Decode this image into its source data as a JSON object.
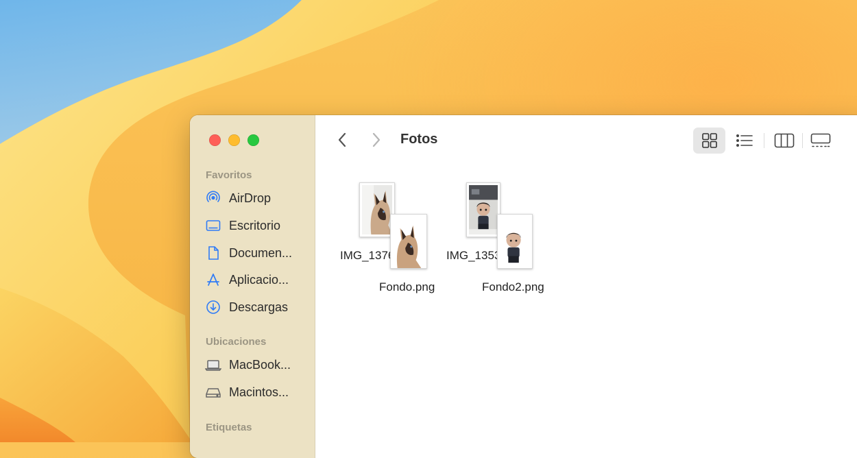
{
  "sidebar": {
    "favorites_title": "Favoritos",
    "favorites": [
      {
        "label": "AirDrop",
        "icon": "airdrop-icon"
      },
      {
        "label": "Escritorio",
        "icon": "desktop-icon"
      },
      {
        "label": "Documen...",
        "icon": "document-icon"
      },
      {
        "label": "Aplicacio...",
        "icon": "applications-icon"
      },
      {
        "label": "Descargas",
        "icon": "download-icon"
      }
    ],
    "locations_title": "Ubicaciones",
    "locations": [
      {
        "label": "MacBook...",
        "icon": "laptop-icon"
      },
      {
        "label": "Macintos...",
        "icon": "hard-drive-icon"
      }
    ],
    "tags_title": "Etiquetas"
  },
  "toolbar": {
    "title": "Fotos",
    "views": [
      "grid-view-icon",
      "list-view-icon",
      "column-view-icon",
      "gallery-view-icon"
    ]
  },
  "files": [
    {
      "name": "IMG_1376.jpg"
    },
    {
      "name": "Fondo.png"
    },
    {
      "name": "IMG_1353.jpg"
    },
    {
      "name": "Fondo2.png"
    }
  ],
  "colors": {
    "accent": "#2f7bf6",
    "sidebar_bg": "#ece2c4",
    "close": "#fe5f57",
    "minimize": "#febc2e",
    "zoom": "#28c840"
  }
}
